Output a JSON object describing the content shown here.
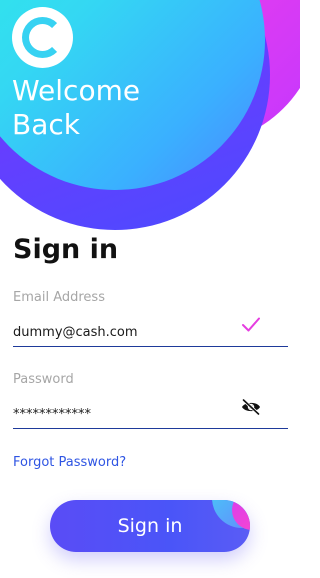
{
  "hero": {
    "welcome_text": "Welcome Back"
  },
  "form": {
    "heading": "Sign in",
    "email": {
      "label": "Email Address",
      "value": "dummy@cash.com"
    },
    "password": {
      "label": "Password",
      "value": "************"
    },
    "forgot_link": "Forgot Password?",
    "submit_label": "Sign in"
  },
  "icons": {
    "logo": "c-logo-icon",
    "email_valid": "checkmark-icon",
    "password_visibility": "eye-off-icon"
  },
  "colors": {
    "accent_cyan": "#37d2f2",
    "accent_purple": "#6a3cff",
    "accent_pink": "#ff4fd8",
    "check": "#e53de0",
    "field_underline": "#1e3a9a",
    "link": "#2f55e3",
    "button": "#4a55f8"
  }
}
